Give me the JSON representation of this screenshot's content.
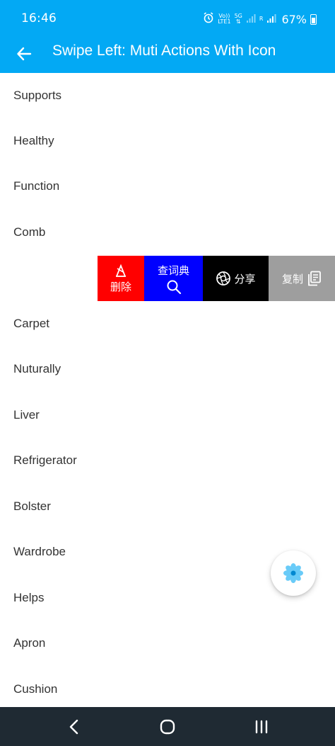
{
  "status": {
    "time": "16:46",
    "volte_top": "Vo))",
    "volte_bottom": "LTE1",
    "net": "5G",
    "roaming": "R",
    "battery": "67%"
  },
  "appbar": {
    "title": "Swipe Left: Muti Actions With Icon"
  },
  "list": {
    "items": [
      {
        "label": "Supports"
      },
      {
        "label": "Healthy"
      },
      {
        "label": "Function"
      },
      {
        "label": "Comb"
      },
      {
        "label": ""
      },
      {
        "label": "Carpet"
      },
      {
        "label": "Nuturally"
      },
      {
        "label": "Liver"
      },
      {
        "label": "Refrigerator"
      },
      {
        "label": "Bolster"
      },
      {
        "label": "Wardrobe"
      },
      {
        "label": "Helps"
      },
      {
        "label": "Apron"
      },
      {
        "label": "Cushion"
      }
    ]
  },
  "swipe_actions": {
    "delete": "删除",
    "dictionary": "查词典",
    "share": "分享",
    "copy": "复制"
  },
  "colors": {
    "appbar": "#03A9F4",
    "delete": "#FF0000",
    "dictionary": "#0000FF",
    "share": "#000000",
    "copy": "#9E9E9E",
    "navbar": "#1F2A33",
    "fab_icon": "#4FC3F7"
  },
  "icons": {
    "back": "arrow-back-icon",
    "delete": "delete-icon",
    "dictionary": "search-icon",
    "share": "share-aperture-icon",
    "copy": "copy-icon",
    "fab": "flower-icon"
  }
}
